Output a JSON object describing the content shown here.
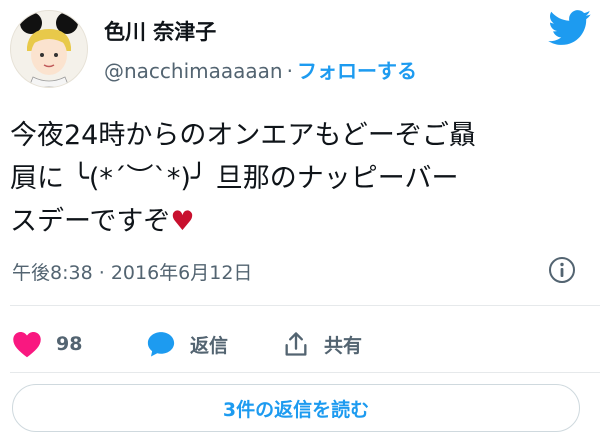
{
  "author": {
    "display_name": "色川 奈津子",
    "handle": "@nacchimaaaaan",
    "separator": "·",
    "follow_label": "フォローする"
  },
  "tweet": {
    "line1": "今夜24時からのオンエアもどーぞご贔",
    "line2": "屓に ╰(*´︶`*)╯ 旦那のナッピーバー",
    "line3": "スデーですぞ",
    "heart": "♥"
  },
  "meta": {
    "time": "午後8:38",
    "separator": "·",
    "date": "2016年6月12日"
  },
  "actions": {
    "like_count": "98",
    "reply_label": "返信",
    "share_label": "共有"
  },
  "replies_button": {
    "label": "3件の返信を読む"
  },
  "colors": {
    "accent": "#1d9bf0",
    "like": "#f91880",
    "text": "#0f1419",
    "muted": "#536471"
  },
  "icons": [
    "twitter-bird-icon",
    "info-icon",
    "heart-icon",
    "reply-bubble-icon",
    "share-icon"
  ]
}
